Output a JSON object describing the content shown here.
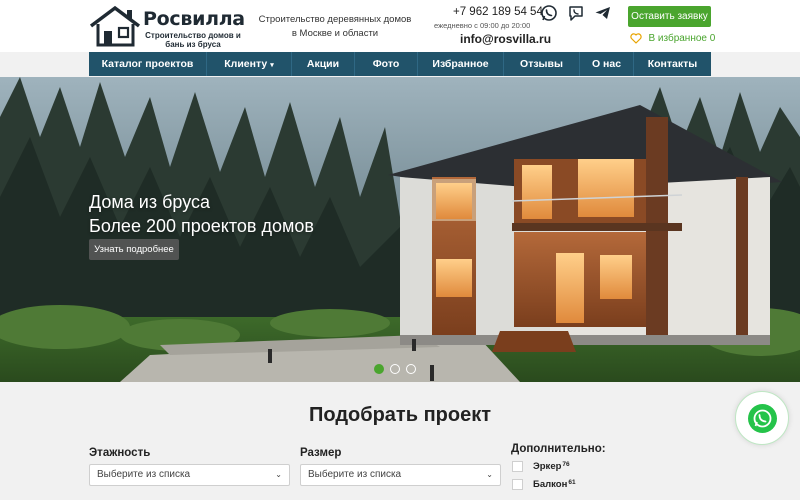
{
  "header": {
    "logo_name": "Росвилла",
    "logo_tagline": "Строительство домов и бань из бруса",
    "tagline_line1": "Строительство деревянных домов",
    "tagline_line2": "в Москве и области",
    "phone": "+7 962 189 54 54",
    "hours": "ежедневно с 09:00 до 20:00",
    "email": "info@rosvilla.ru",
    "cta_label": "Оставить заявку",
    "favorites_label": "В избранное 0",
    "messengers": [
      "whatsapp-icon",
      "viber-icon",
      "telegram-icon"
    ]
  },
  "nav": {
    "items": [
      {
        "label": "Каталог проектов"
      },
      {
        "label": "Клиенту",
        "caret": "▾"
      },
      {
        "label": "Акции"
      },
      {
        "label": "Фото"
      },
      {
        "label": "Избранное"
      },
      {
        "label": "Отзывы"
      },
      {
        "label": "О нас"
      },
      {
        "label": "Контакты"
      }
    ]
  },
  "hero": {
    "title_line1": "Дома из бруса",
    "title_line2": "Более 200 проектов домов",
    "button_label": "Узнать подробнее",
    "slides": 3,
    "active_slide": 1
  },
  "filter": {
    "title": "Подобрать проект",
    "floors_label": "Этажность",
    "floors_value": "Выберите из списка",
    "size_label": "Размер",
    "size_value": "Выберите из списка",
    "extra_label": "Дополнительно:",
    "options": [
      {
        "label": "Эркер",
        "count": "76"
      },
      {
        "label": "Балкон",
        "count": "61"
      }
    ]
  },
  "colors": {
    "accent_green": "#4aa52e",
    "nav_blue": "#21536a",
    "whatsapp": "#25c34a"
  }
}
